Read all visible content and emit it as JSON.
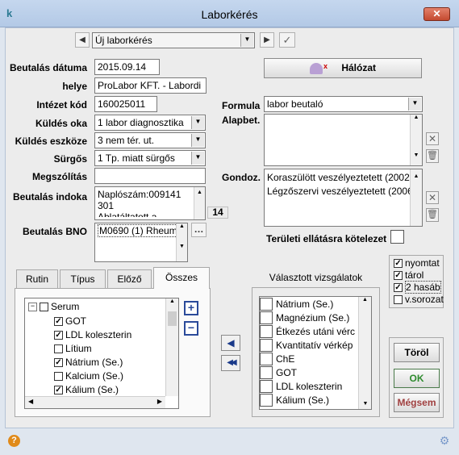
{
  "window": {
    "title": "Laborkérés",
    "close_symbol": "✕"
  },
  "nav": {
    "selector_value": "Új laborkérés"
  },
  "form": {
    "beutalas_datuma_label": "Beutalás dátuma",
    "beutalas_datuma_value": "2015.09.14",
    "helye_label": "helye",
    "helye_value": "ProLabor KFT. - Labordi",
    "intezet_kod_label": "Intézet kód",
    "intezet_kod_value": "160025011",
    "kuldes_oka_label": "Küldés oka",
    "kuldes_oka_value": "1 labor diagnosztika",
    "kuldes_eszkoze_label": "Küldés eszköze",
    "kuldes_eszkoze_value": "3 nem tér. ut.",
    "surgos_label": "Sürgős",
    "surgos_value": "1 Tp. miatt sürgős",
    "megszolitas_label": "Megszólítás",
    "megszolitas_value": "",
    "beutalas_indoka_label": "Beutalás indoka",
    "beutalas_indoka_lines": [
      "Naplószám:009141",
      "301",
      "Ablatáltatott a"
    ],
    "indoka_count": "14",
    "beutalas_bno_label": "Beutalás BNO",
    "beutalas_bno_value": "M0690 (1) Rheum"
  },
  "right": {
    "halozat_label": "Hálózat",
    "formula_label": "Formula",
    "formula_value": "labor beutaló",
    "alapbet_label": "Alapbet.",
    "gondoz_label": "Gondoz.",
    "gondoz_lines": [
      "Koraszülött veszélyeztetett (2002",
      "Légzőszervi veszélyeztetett (2006"
    ],
    "teruleti_label": "Területi ellátásra kötelezet"
  },
  "tabs": [
    {
      "label": "Rutin"
    },
    {
      "label": "Típus"
    },
    {
      "label": "Előző"
    },
    {
      "label": "Összes"
    }
  ],
  "tree": {
    "root": "Serum",
    "items": [
      {
        "label": "GOT",
        "checked": true
      },
      {
        "label": "LDL koleszterin",
        "checked": true
      },
      {
        "label": "Lítium",
        "checked": false
      },
      {
        "label": "Nátrium (Se.)",
        "checked": true
      },
      {
        "label": "Kalcium (Se.)",
        "checked": false
      },
      {
        "label": "Kálium (Se.)",
        "checked": true
      }
    ]
  },
  "selected": {
    "title": "Választott vizsgálatok",
    "items": [
      "Nátrium (Se.)",
      "Magnézium (Se.)",
      "Étkezés utáni vérc",
      "Kvantitatív vérkép",
      "ChE",
      "GOT",
      "LDL koleszterin",
      "Kálium (Se.)"
    ]
  },
  "options": [
    {
      "label": "nyomtat",
      "checked": true
    },
    {
      "label": "tárol",
      "checked": true
    },
    {
      "label": "2 hasáb",
      "checked": true
    },
    {
      "label": "v.sorozat",
      "checked": false
    }
  ],
  "buttons": {
    "torol": "Töröl",
    "ok": "OK",
    "megsem": "Mégsem"
  },
  "colors": {
    "ok_text": "#2e8b2e",
    "megsem_text": "#a04040",
    "titlebar": "#b9cde8"
  }
}
